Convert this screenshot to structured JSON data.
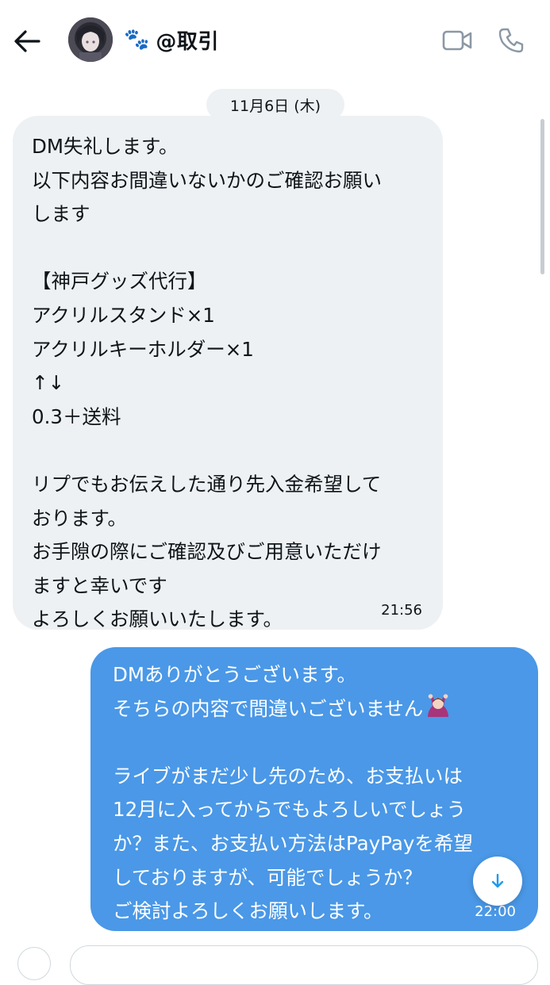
{
  "header": {
    "contact_name": "@取引",
    "paw_emoji": "🐾",
    "back_icon": "arrow-left-icon",
    "video_icon": "video-camera-icon",
    "phone_icon": "phone-icon"
  },
  "date_separator": "11月6日 (木)",
  "messages": [
    {
      "direction": "received",
      "text": "DM失礼します。\n以下内容お間違いないかのご確認お願い\nします\n\n【神戸グッズ代行】\nアクリルスタンド×1\nアクリルキーホルダー×1\n↑↓\n0.3＋送料\n\nリプでもお伝えした通り先入金希望して\nおります。\nお手隙の際にご確認及びご用意いただけ\nますと幸いです\nよろしくお願いいたします。",
      "time": "21:56"
    },
    {
      "direction": "sent",
      "text_part1": "DMありがとうございます。\nそちらの内容で間違いございません",
      "emoji": "person-gesturing-ok-icon",
      "text_part2": "\n\nライブがまだ少し先のため、お支払いは\n12月に入ってからでもよろしいでしょう\nか？また、お支払い方法はPayPayを希望\nしておりますが、可能でしょうか？\nご検討よろしくお願いします。",
      "time": "22:00"
    }
  ],
  "scroll_down_icon": "arrow-down-icon",
  "colors": {
    "received_bubble": "#eef1f3",
    "sent_bubble": "#4a98e7",
    "accent": "#1d9bf0",
    "text": "#0f1419",
    "icon_gray": "#8b98a5"
  }
}
